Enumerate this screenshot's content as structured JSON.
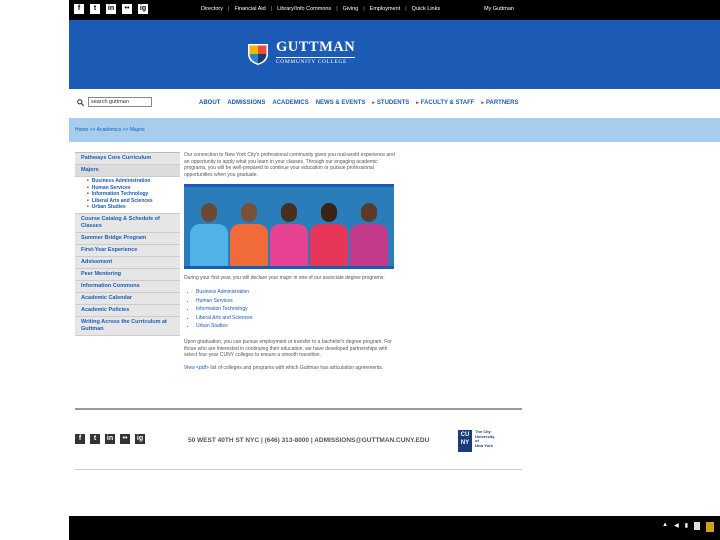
{
  "topbar": {
    "social": [
      "f",
      "t",
      "in",
      "••",
      "ig"
    ],
    "links": [
      "Directory",
      "Financial Aid",
      "Library/Info Commons",
      "Giving",
      "Employment",
      "Quick Links"
    ],
    "my_guttman": "My Guttman"
  },
  "header": {
    "logo_name": "GUTTMAN",
    "logo_sub": "COMMUNITY COLLEGE",
    "bg_color": "#1b5bb5"
  },
  "nav": {
    "search_value": "search guttman",
    "items": [
      {
        "label": "ABOUT",
        "arrow": false
      },
      {
        "label": "ADMISSIONS",
        "arrow": false
      },
      {
        "label": "ACADEMICS",
        "arrow": false
      },
      {
        "label": "NEWS & EVENTS",
        "arrow": false
      },
      {
        "label": "STUDENTS",
        "arrow": true
      },
      {
        "label": "FACULTY & STAFF",
        "arrow": true
      },
      {
        "label": "PARTNERS",
        "arrow": true
      }
    ]
  },
  "breadcrumb": "Home >> Academics >> Majors",
  "sidebar": {
    "items": [
      "Pathways Core Curriculum",
      "Majors",
      "Course Catalog & Schedule of Classes",
      "Summer Bridge Program",
      "First-Year Experience",
      "Advisement",
      "Peer Mentoring",
      "Information Commons",
      "Academic Calendar",
      "Academic Policies",
      "Writing Across the Curriculum at Guttman"
    ],
    "majors_sub": [
      "Business Administration",
      "Human Services",
      "Information Technology",
      "Liberal Arts and Sciences",
      "Urban Studies"
    ]
  },
  "main": {
    "intro": "Our connection to New York City's professional community gives you real-world experience and an opportunity to apply what you learn in your classes. Through our engaging academic programs, you will be well-prepared to continue your education or pursue professional opportunities when you graduate.",
    "first_year": "During your first year, you will declare your major in one of our associate degree programs:",
    "majors": [
      "Business Administration",
      "Human Services",
      "Information Technology",
      "Liberal Arts and Sciences",
      "Urban Studies"
    ],
    "graduation": "Upon graduation, you can pursue employment or transfer to a bachelor's degree program. For those who are interested in continuing their education, we have developed partnerships with select four-year CUNY colleges to ensure a smooth transition.",
    "view_link": "View",
    "pdf_link": "<pdf>",
    "view_rest": "list of colleges and programs with which Guttman has articulation agreements."
  },
  "footer": {
    "address": "50 WEST 40TH ST NYC | (646) 313-8000 | ADMISSIONS@GUTTMAN.CUNY.EDU",
    "cuny_mark": "CU NY",
    "cuny_text": [
      "The City",
      "University",
      "of",
      "New York"
    ]
  },
  "colors": {
    "shirts": [
      "#e84393",
      "#f06a3a",
      "#e8365a",
      "#e8365a",
      "#c33a8a"
    ]
  }
}
